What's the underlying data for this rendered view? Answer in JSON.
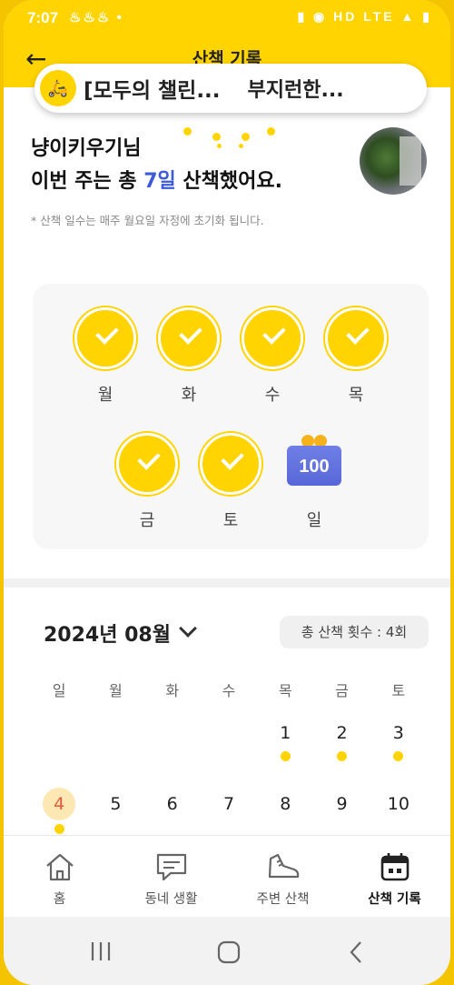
{
  "status_bar": {
    "time": "7:07",
    "left_icons": "♨♨♨ •",
    "right_icons": "▮ ◉ HD LTE ▲ ▮"
  },
  "header": {
    "title": "산책 기록"
  },
  "banner": {
    "left_text": "[모두의 챌린...",
    "right_text": "부지런한..."
  },
  "summary": {
    "user_line": "냥이키우기님",
    "week_prefix": "이번 주는 총 ",
    "week_count": "7일",
    "week_suffix": " 산책했어요.",
    "note": "* 산책 일수는 매주 월요일 자정에 초기화 됩니다."
  },
  "week_days": [
    {
      "label": "월",
      "status": "checked"
    },
    {
      "label": "화",
      "status": "checked"
    },
    {
      "label": "수",
      "status": "checked"
    },
    {
      "label": "목",
      "status": "checked"
    },
    {
      "label": "금",
      "status": "checked"
    },
    {
      "label": "토",
      "status": "checked"
    },
    {
      "label": "일",
      "status": "gift",
      "gift_text": "100"
    }
  ],
  "calendar": {
    "month_title": "2024년 08월",
    "total_label": "총 산책 횟수 : 4회",
    "weekday_headers": [
      "일",
      "월",
      "화",
      "수",
      "목",
      "금",
      "토"
    ],
    "row1": [
      "",
      "",
      "",
      "",
      "1",
      "2",
      "3"
    ],
    "row2": [
      "4",
      "5",
      "6",
      "7",
      "8",
      "9",
      "10"
    ],
    "today": "4",
    "walked_days": [
      "1",
      "2",
      "3",
      "4"
    ]
  },
  "bottom_nav": {
    "items": [
      {
        "label": "홈",
        "icon": "home-icon"
      },
      {
        "label": "동네 생활",
        "icon": "chat-icon"
      },
      {
        "label": "주변 산책",
        "icon": "sneaker-icon"
      },
      {
        "label": "산책 기록",
        "icon": "calendar-icon",
        "active": true
      }
    ]
  },
  "colors": {
    "accent": "#ffd400",
    "highlight_blue": "#3d5bd9",
    "today_text": "#e35b3c"
  }
}
